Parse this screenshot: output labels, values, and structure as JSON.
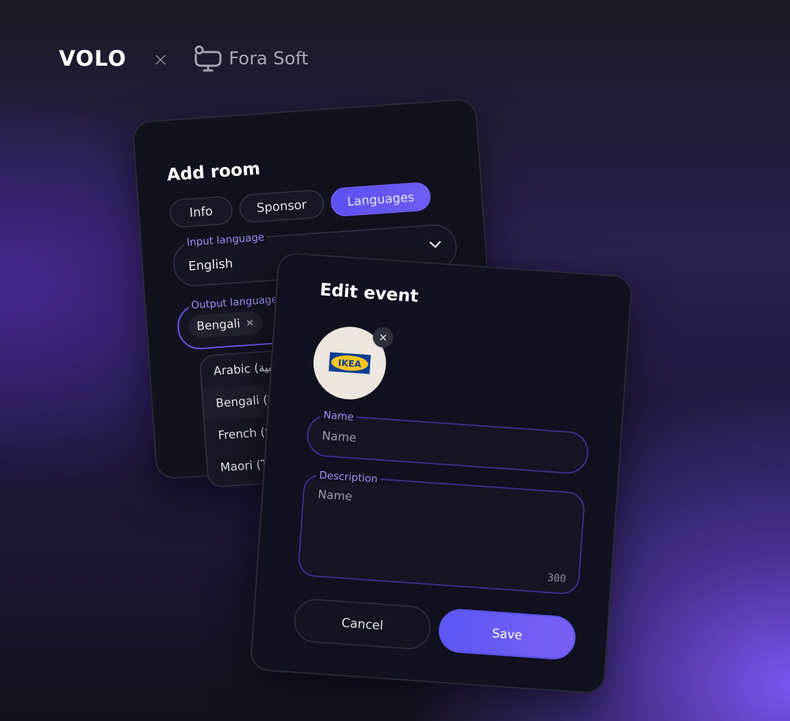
{
  "brand": {
    "left_name": "VOLO",
    "separator": "×",
    "right_name": "Fora Soft"
  },
  "add_room": {
    "title": "Add room",
    "tabs": [
      {
        "label": "Info",
        "active": false
      },
      {
        "label": "Sponsor",
        "active": false
      },
      {
        "label": "Languages",
        "active": true
      }
    ],
    "input_language": {
      "label": "Input language",
      "value": "English"
    },
    "output_language": {
      "label": "Output language",
      "chips": [
        "Bengali"
      ]
    },
    "dropdown_options": [
      "Arabic (عربية)",
      "Bengali (বাংলা)",
      "French (français)",
      "Maori (Te Reo Māori)"
    ]
  },
  "edit_event": {
    "title": "Edit event",
    "logo_text": "IKEA",
    "name": {
      "label": "Name",
      "placeholder": "Name"
    },
    "description": {
      "label": "Description",
      "placeholder": "Name",
      "counter": "300"
    },
    "cancel_label": "Cancel",
    "save_label": "Save"
  },
  "colors": {
    "accent": "#6b5cf5",
    "card_bg": "#12121f",
    "label": "#9d8ff5"
  }
}
